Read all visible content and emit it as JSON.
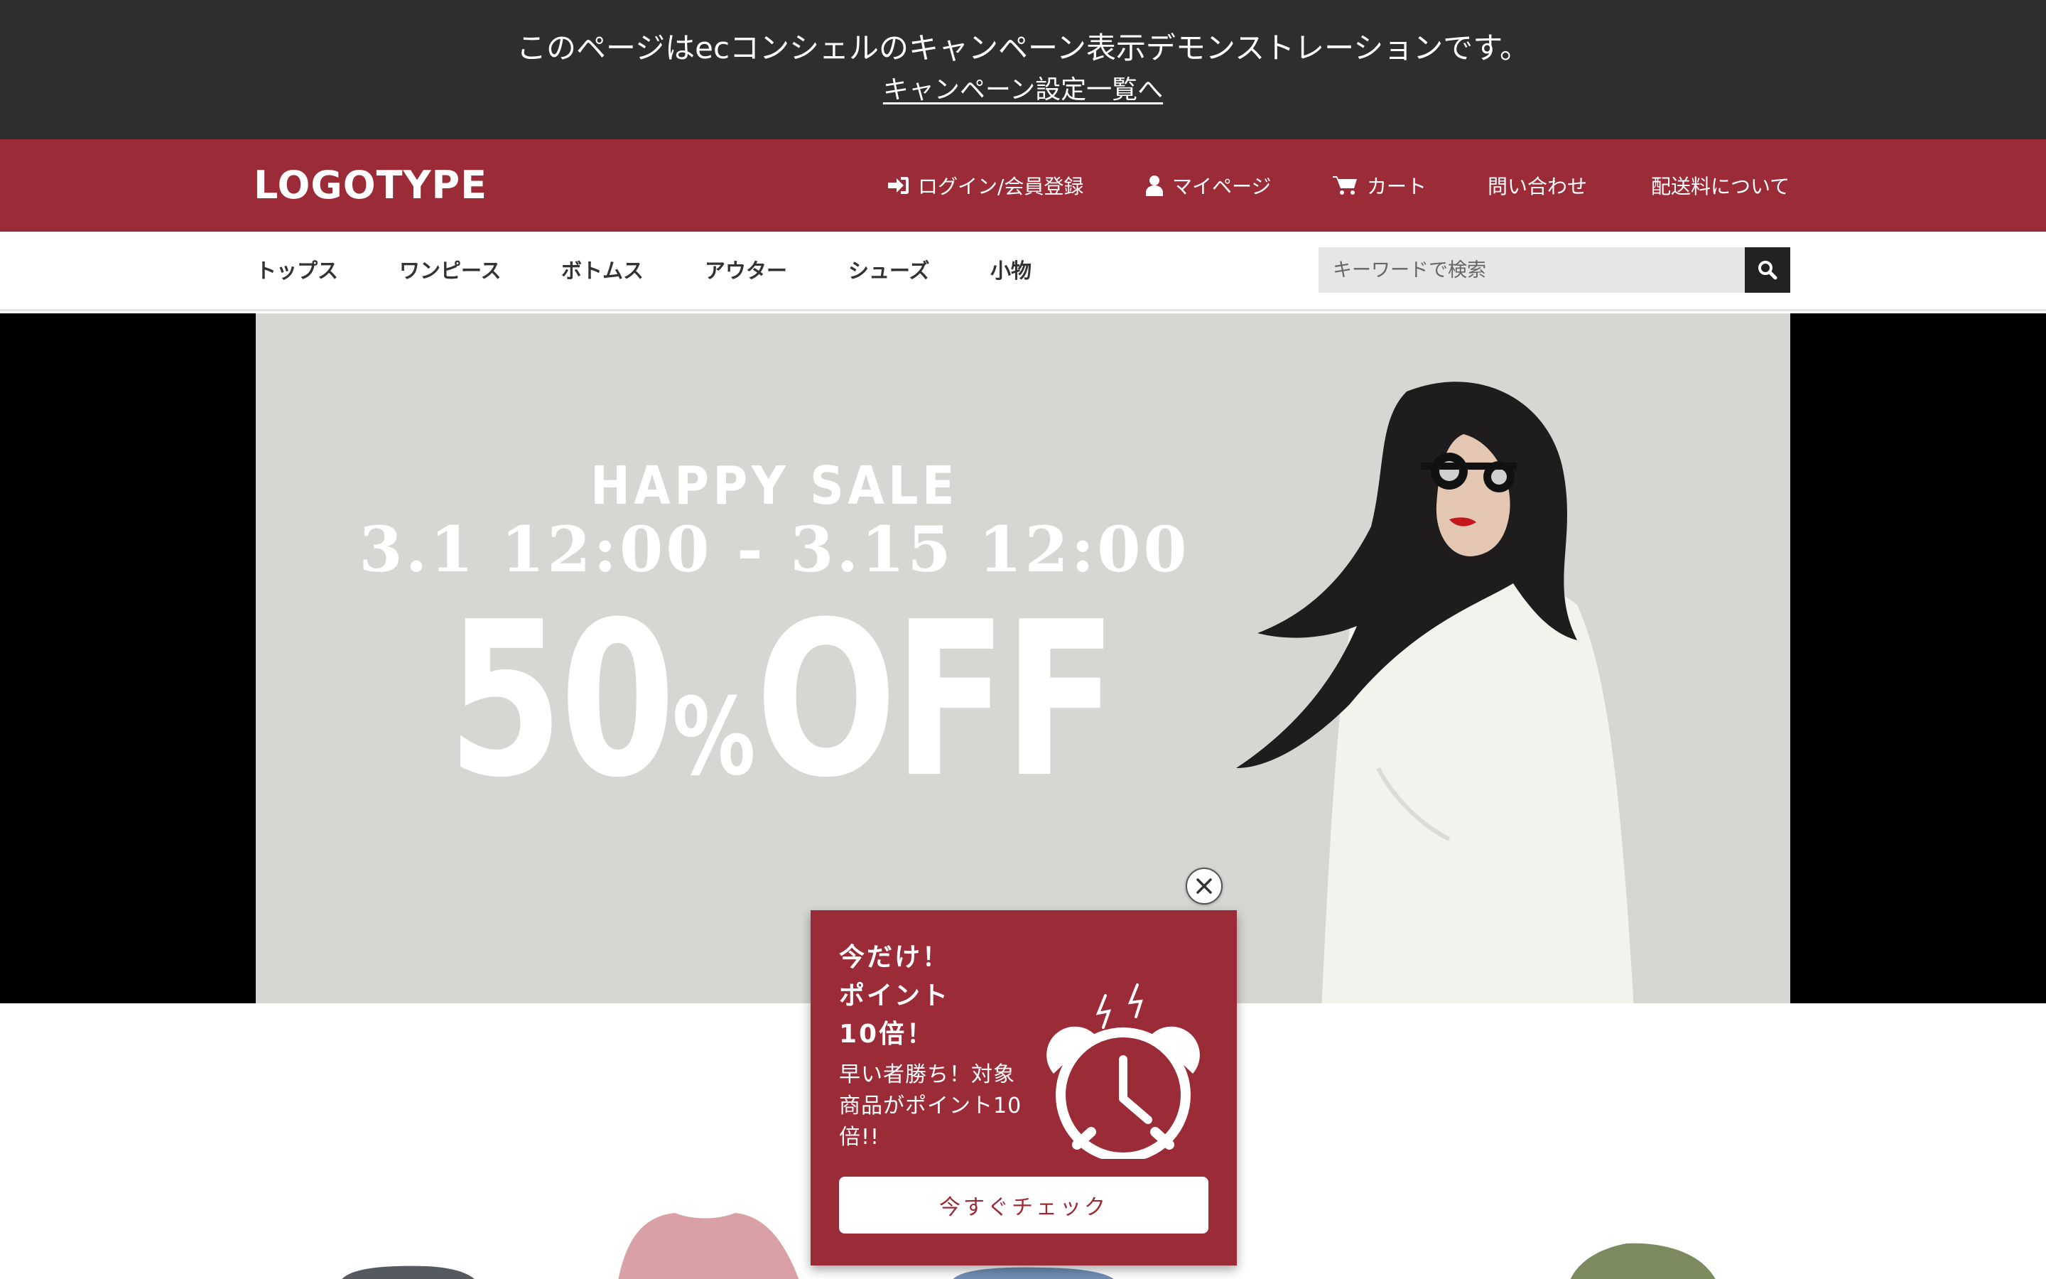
{
  "demo_banner": {
    "message": "このページはecコンシェルのキャンペーン表示デモンストレーションです。",
    "link": "キャンペーン設定一覧へ"
  },
  "header": {
    "logo": "LOGOTYPE",
    "nav": [
      {
        "label": "ログイン/会員登録",
        "icon": "sign-in-icon"
      },
      {
        "label": "マイページ",
        "icon": "user-icon"
      },
      {
        "label": "カート",
        "icon": "cart-icon"
      },
      {
        "label": "問い合わせ",
        "icon": ""
      },
      {
        "label": "配送料について",
        "icon": ""
      }
    ]
  },
  "categories": [
    "トップス",
    "ワンピース",
    "ボトムス",
    "アウター",
    "シューズ",
    "小物"
  ],
  "search": {
    "placeholder": "キーワードで検索",
    "icon": "search-icon"
  },
  "hero": {
    "title": "HAPPY SALE",
    "period": "3.1 12:00 - 3.15 12:00",
    "discount_number": "50",
    "discount_percent": "%",
    "discount_word": "OFF"
  },
  "popup": {
    "headline": [
      "今だけ！",
      "ポイント",
      "10倍！"
    ],
    "body": "早い者勝ち！対象商品がポイント10倍!!",
    "button": "今すぐチェック",
    "icon": "alarm-clock-icon",
    "close_icon": "close-icon"
  },
  "colors": {
    "brand": "#9b2b37",
    "demo_bar": "#2e2e2e",
    "hero_bg": "#d6d7d2"
  }
}
